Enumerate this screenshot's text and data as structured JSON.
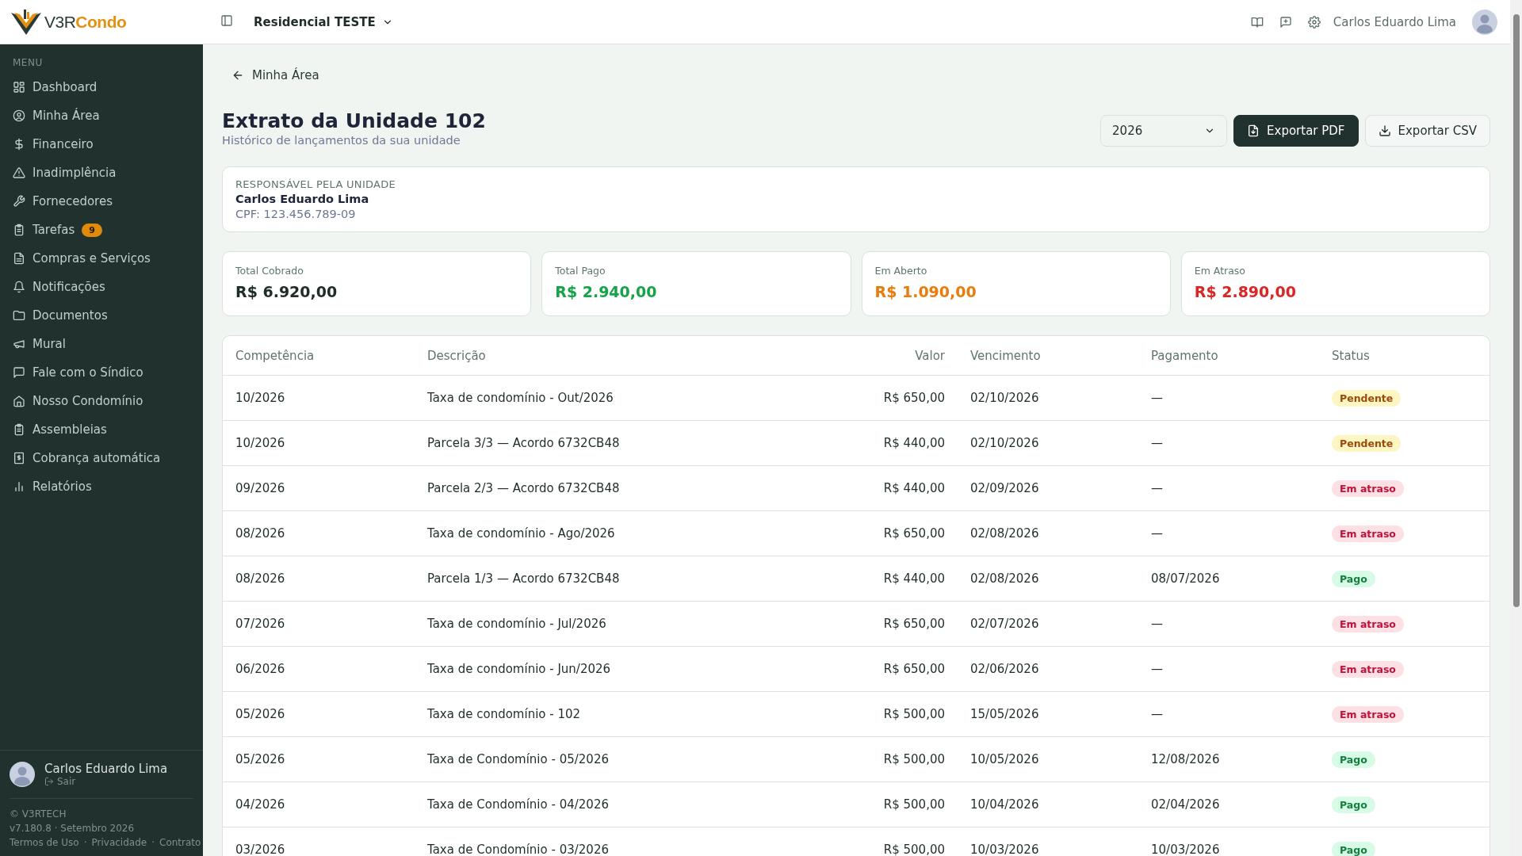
{
  "logo": {
    "text_dark": "V3R",
    "text_accent": "Condo"
  },
  "header": {
    "condominium": "Residencial TESTE",
    "user_name": "Carlos Eduardo Lima"
  },
  "sidebar": {
    "section": "MENU",
    "items": [
      {
        "label": "Dashboard"
      },
      {
        "label": "Minha Área"
      },
      {
        "label": "Financeiro"
      },
      {
        "label": "Inadimplência"
      },
      {
        "label": "Fornecedores"
      },
      {
        "label": "Tarefas",
        "badge": "9"
      },
      {
        "label": "Compras e Serviços"
      },
      {
        "label": "Notificações"
      },
      {
        "label": "Documentos"
      },
      {
        "label": "Mural"
      },
      {
        "label": "Fale com o Síndico"
      },
      {
        "label": "Nosso Condomínio"
      },
      {
        "label": "Assembleias"
      },
      {
        "label": "Cobrança automática"
      },
      {
        "label": "Relatórios"
      }
    ],
    "user": {
      "name": "Carlos Eduardo Lima",
      "logout": "Sair"
    },
    "copyright": "© V3RTECH",
    "version": "v7.180.8 · Setembro 2026",
    "separator": "·",
    "links": [
      "Termos de Uso",
      "Privacidade",
      "Contrato"
    ]
  },
  "back_link": "Minha Área",
  "page": {
    "title": "Extrato da Unidade 102",
    "subtitle": "Histórico de lançamentos da sua unidade"
  },
  "year_select": {
    "value": "2026"
  },
  "buttons": [
    {
      "label": "Exportar PDF",
      "kind": "primary"
    },
    {
      "label": "Exportar CSV",
      "kind": "secondary"
    }
  ],
  "responsible": {
    "heading": "RESPONSÁVEL PELA UNIDADE",
    "name": "Carlos Eduardo Lima",
    "document": "CPF: 123.456.789-09"
  },
  "stats": [
    {
      "label": "Total Cobrado",
      "value": "R$ 6.920,00",
      "color": "#1f2d2a"
    },
    {
      "label": "Total Pago",
      "value": "R$ 2.940,00",
      "color": "#16a34a"
    },
    {
      "label": "Em Aberto",
      "value": "R$ 1.090,00",
      "color": "#ea7c0c"
    },
    {
      "label": "Em Atraso",
      "value": "R$ 2.890,00",
      "color": "#dc2626"
    }
  ],
  "table": {
    "columns": [
      "Competência",
      "Descrição",
      "Valor",
      "Vencimento",
      "Pagamento",
      "Status"
    ],
    "rows": [
      {
        "period": "10/2026",
        "description": "Taxa de condomínio - Out/2026",
        "amount": "R$ 650,00",
        "due": "02/10/2026",
        "paid_on": "—",
        "status": "Pendente",
        "kind": "pending"
      },
      {
        "period": "10/2026",
        "description": "Parcela 3/3 — Acordo 6732CB48",
        "amount": "R$ 440,00",
        "due": "02/10/2026",
        "paid_on": "—",
        "status": "Pendente",
        "kind": "pending"
      },
      {
        "period": "09/2026",
        "description": "Parcela 2/3 — Acordo 6732CB48",
        "amount": "R$ 440,00",
        "due": "02/09/2026",
        "paid_on": "—",
        "status": "Em atraso",
        "kind": "overdue"
      },
      {
        "period": "08/2026",
        "description": "Taxa de condomínio - Ago/2026",
        "amount": "R$ 650,00",
        "due": "02/08/2026",
        "paid_on": "—",
        "status": "Em atraso",
        "kind": "overdue"
      },
      {
        "period": "08/2026",
        "description": "Parcela 1/3 — Acordo 6732CB48",
        "amount": "R$ 440,00",
        "due": "02/08/2026",
        "paid_on": "08/07/2026",
        "status": "Pago",
        "kind": "paid"
      },
      {
        "period": "07/2026",
        "description": "Taxa de condomínio - Jul/2026",
        "amount": "R$ 650,00",
        "due": "02/07/2026",
        "paid_on": "—",
        "status": "Em atraso",
        "kind": "overdue"
      },
      {
        "period": "06/2026",
        "description": "Taxa de condomínio - Jun/2026",
        "amount": "R$ 650,00",
        "due": "02/06/2026",
        "paid_on": "—",
        "status": "Em atraso",
        "kind": "overdue"
      },
      {
        "period": "05/2026",
        "description": "Taxa de condomínio - 102",
        "amount": "R$ 500,00",
        "due": "15/05/2026",
        "paid_on": "—",
        "status": "Em atraso",
        "kind": "overdue"
      },
      {
        "period": "05/2026",
        "description": "Taxa de Condomínio - 05/2026",
        "amount": "R$ 500,00",
        "due": "10/05/2026",
        "paid_on": "12/08/2026",
        "status": "Pago",
        "kind": "paid"
      },
      {
        "period": "04/2026",
        "description": "Taxa de Condomínio - 04/2026",
        "amount": "R$ 500,00",
        "due": "10/04/2026",
        "paid_on": "02/04/2026",
        "status": "Pago",
        "kind": "paid"
      },
      {
        "period": "03/2026",
        "description": "Taxa de Condomínio - 03/2026",
        "amount": "R$ 500,00",
        "due": "10/03/2026",
        "paid_on": "10/03/2026",
        "status": "Pago",
        "kind": "paid"
      }
    ]
  }
}
